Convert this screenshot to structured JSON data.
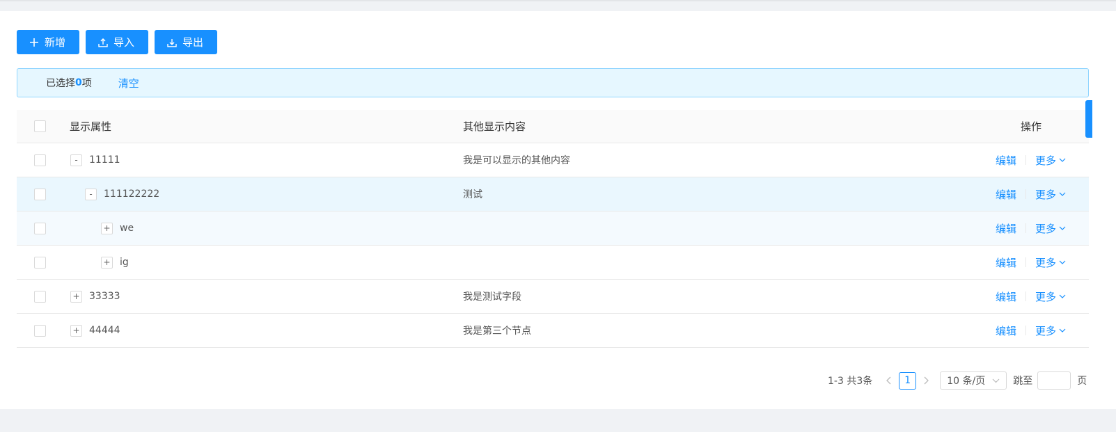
{
  "toolbar": {
    "add_label": "新增",
    "import_label": "导入",
    "export_label": "导出"
  },
  "selection": {
    "prefix": "已选择",
    "count": "0",
    "suffix": "项",
    "clear_label": "清空"
  },
  "table": {
    "columns": {
      "name": "显示属性",
      "other": "其他显示内容",
      "ops": "操作"
    },
    "rows": [
      {
        "expander": "-",
        "name": "11111",
        "other": "我是可以显示的其他内容",
        "indent_level": 0
      },
      {
        "expander": "-",
        "name": "111122222",
        "other": "测试",
        "indent_level": 1
      },
      {
        "expander": "+",
        "name": "we",
        "other": "",
        "indent_level": 2
      },
      {
        "expander": "+",
        "name": "ig",
        "other": "",
        "indent_level": 2
      },
      {
        "expander": "+",
        "name": "33333",
        "other": "我是测试字段",
        "indent_level": 0
      },
      {
        "expander": "+",
        "name": "44444",
        "other": "我是第三个节点",
        "indent_level": 0
      }
    ],
    "edit_label": "编辑",
    "more_label": "更多"
  },
  "pagination": {
    "total_text": "1-3 共3条",
    "current_page": "1",
    "page_size": "10 条/页",
    "jump_label": "跳至",
    "page_label": "页"
  },
  "colors": {
    "primary": "#1890ff",
    "alert_bg": "#e6f7ff",
    "alert_border": "#91d5ff"
  }
}
